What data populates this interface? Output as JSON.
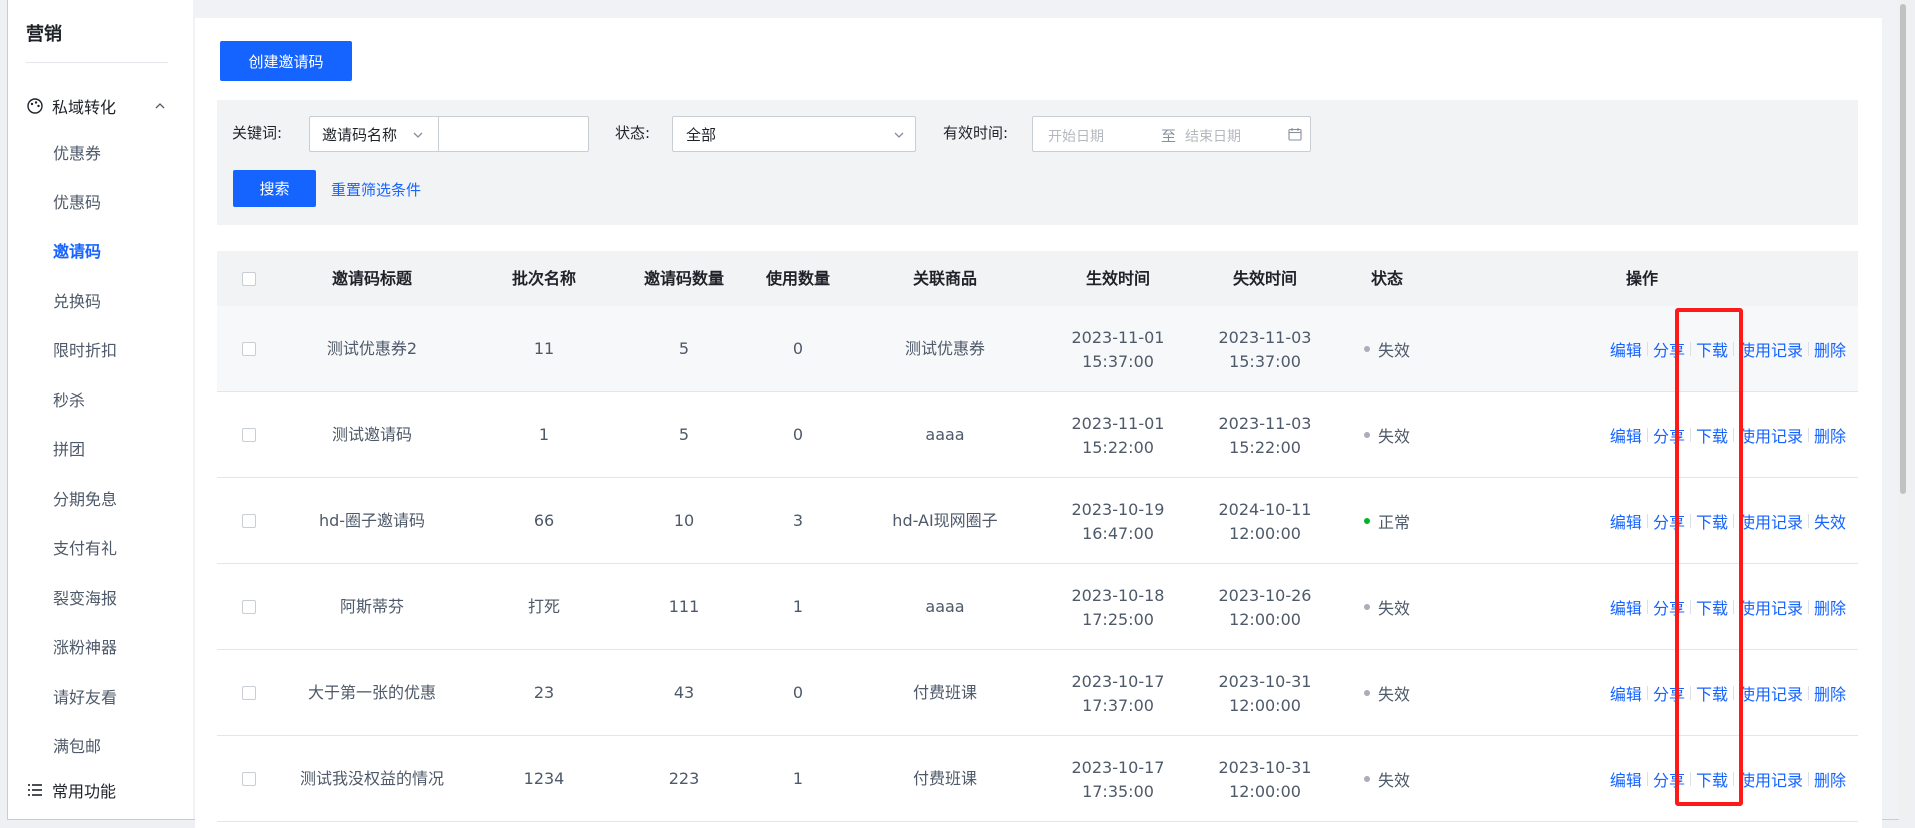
{
  "sidebar": {
    "title": "营销",
    "group": {
      "label": "私域转化"
    },
    "items": [
      {
        "label": "优惠券",
        "active": false
      },
      {
        "label": "优惠码",
        "active": false
      },
      {
        "label": "邀请码",
        "active": true
      },
      {
        "label": "兑换码",
        "active": false
      },
      {
        "label": "限时折扣",
        "active": false
      },
      {
        "label": "秒杀",
        "active": false
      },
      {
        "label": "拼团",
        "active": false
      },
      {
        "label": "分期免息",
        "active": false
      },
      {
        "label": "支付有礼",
        "active": false
      },
      {
        "label": "裂变海报",
        "active": false
      },
      {
        "label": "涨粉神器",
        "active": false
      },
      {
        "label": "请好友看",
        "active": false
      },
      {
        "label": "满包邮",
        "active": false
      }
    ],
    "footer": {
      "label": "常用功能"
    }
  },
  "toolbar": {
    "create_label": "创建邀请码"
  },
  "filters": {
    "keyword_label": "关键词:",
    "keyword_type": "邀请码名称",
    "keyword_value": "",
    "status_label": "状态:",
    "status_value": "全部",
    "time_label": "有效时间:",
    "start_placeholder": "开始日期",
    "to_label": "至",
    "end_placeholder": "结束日期",
    "search_label": "搜索",
    "reset_label": "重置筛选条件"
  },
  "table": {
    "columns": [
      "邀请码标题",
      "批次名称",
      "邀请码数量",
      "使用数量",
      "关联商品",
      "生效时间",
      "失效时间",
      "状态",
      "操作"
    ],
    "rows": [
      {
        "title": "测试优惠券2",
        "batch": "11",
        "count": "5",
        "used": "0",
        "product": "测试优惠券",
        "start_date": "2023-11-01",
        "start_time": "15:37:00",
        "end_date": "2023-11-03",
        "end_time": "15:37:00",
        "status": "失效",
        "ok": false,
        "actions": [
          "编辑",
          "分享",
          "下载",
          "使用记录",
          "删除"
        ]
      },
      {
        "title": "测试邀请码",
        "batch": "1",
        "count": "5",
        "used": "0",
        "product": "aaaa",
        "start_date": "2023-11-01",
        "start_time": "15:22:00",
        "end_date": "2023-11-03",
        "end_time": "15:22:00",
        "status": "失效",
        "ok": false,
        "actions": [
          "编辑",
          "分享",
          "下载",
          "使用记录",
          "删除"
        ]
      },
      {
        "title": "hd-圈子邀请码",
        "batch": "66",
        "count": "10",
        "used": "3",
        "product": "hd-AI现网圈子",
        "start_date": "2023-10-19",
        "start_time": "16:47:00",
        "end_date": "2024-10-11",
        "end_time": "12:00:00",
        "status": "正常",
        "ok": true,
        "actions": [
          "编辑",
          "分享",
          "下载",
          "使用记录",
          "失效"
        ]
      },
      {
        "title": "阿斯蒂芬",
        "batch": "打死",
        "count": "111",
        "used": "1",
        "product": "aaaa",
        "start_date": "2023-10-18",
        "start_time": "17:25:00",
        "end_date": "2023-10-26",
        "end_time": "12:00:00",
        "status": "失效",
        "ok": false,
        "actions": [
          "编辑",
          "分享",
          "下载",
          "使用记录",
          "删除"
        ]
      },
      {
        "title": "大于第一张的优惠",
        "batch": "23",
        "count": "43",
        "used": "0",
        "product": "付费班课",
        "start_date": "2023-10-17",
        "start_time": "17:37:00",
        "end_date": "2023-10-31",
        "end_time": "12:00:00",
        "status": "失效",
        "ok": false,
        "actions": [
          "编辑",
          "分享",
          "下载",
          "使用记录",
          "删除"
        ]
      },
      {
        "title": "测试我没权益的情况",
        "batch": "1234",
        "count": "223",
        "used": "1",
        "product": "付费班课",
        "start_date": "2023-10-17",
        "start_time": "17:35:00",
        "end_date": "2023-10-31",
        "end_time": "12:00:00",
        "status": "失效",
        "ok": false,
        "actions": [
          "编辑",
          "分享",
          "下载",
          "使用记录",
          "删除"
        ]
      }
    ]
  },
  "colors": {
    "primary": "#1664ff",
    "status_ok": "#00b42a",
    "status_off": "#a9aeb8",
    "highlight": "#ff1a1a"
  }
}
